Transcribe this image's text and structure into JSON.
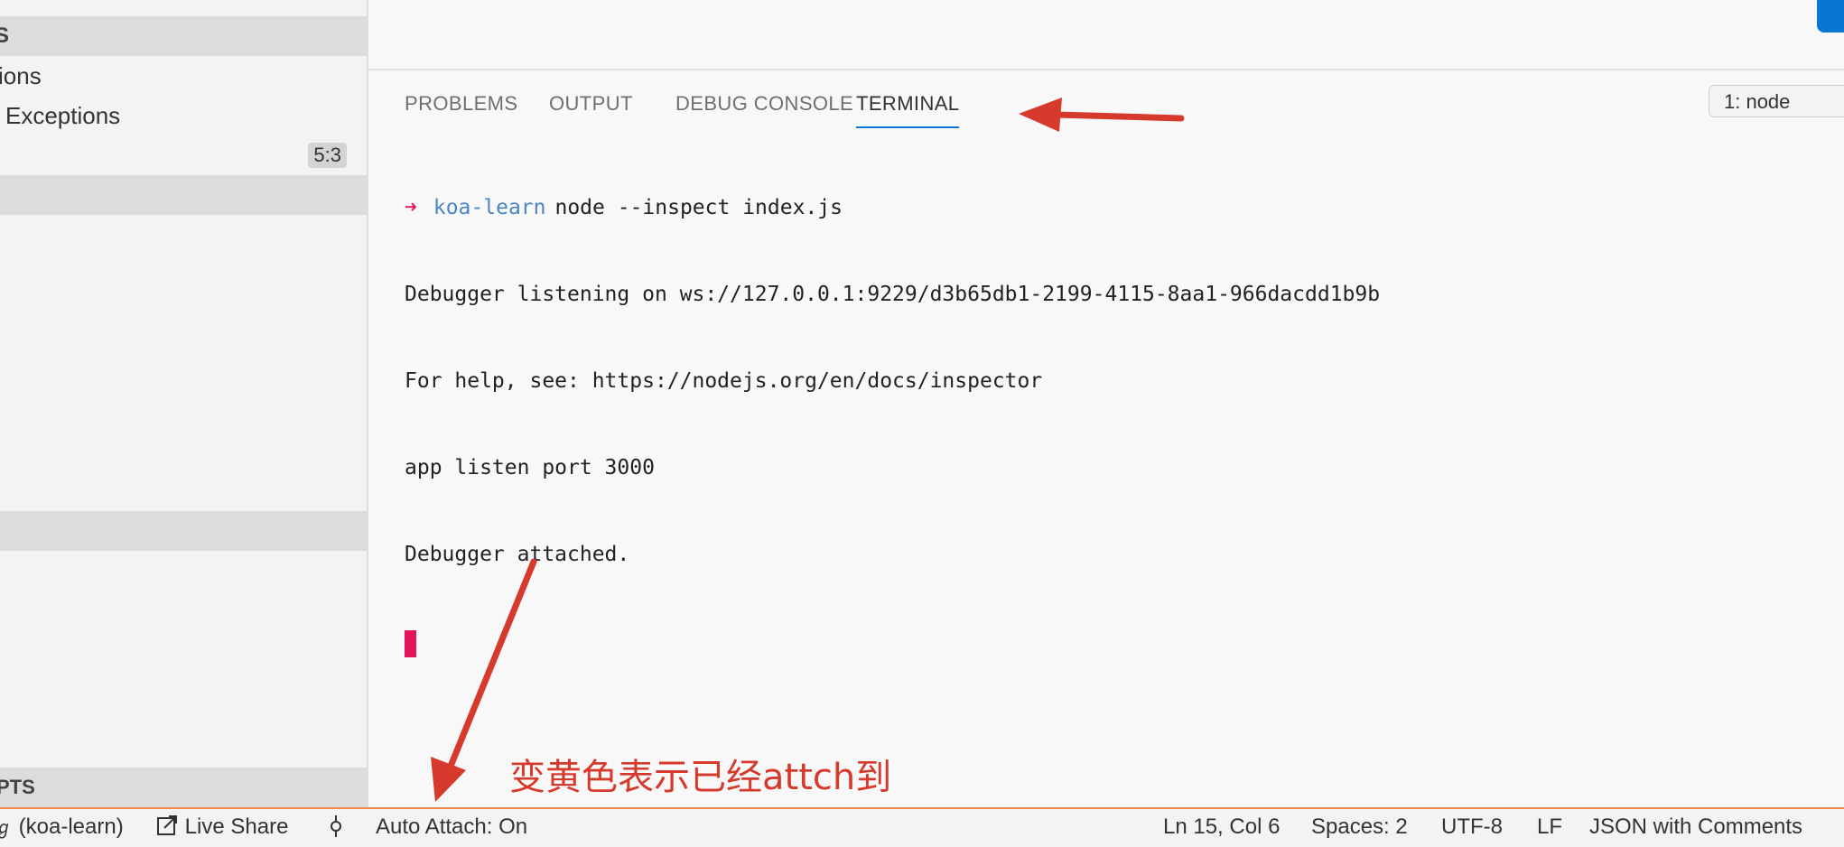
{
  "sidebar": {
    "section_top": "S",
    "item_1": "ions",
    "item_2": "Exceptions",
    "badge": "5:3",
    "section_bottom": "PTS"
  },
  "panel": {
    "tabs": [
      "PROBLEMS",
      "OUTPUT",
      "DEBUG CONSOLE",
      "TERMINAL"
    ],
    "active_tab": "TERMINAL",
    "terminal_selector": "1: node"
  },
  "terminal": {
    "prompt_arrow": "➜",
    "prompt_dir": "koa-learn",
    "command": "node --inspect index.js",
    "lines": [
      "Debugger listening on ws://127.0.0.1:9229/d3b65db1-2199-4115-8aa1-966dacdd1b9b",
      "For help, see: https://nodejs.org/en/docs/inspector",
      "app listen port 3000",
      "Debugger attached."
    ]
  },
  "annotation": {
    "text": "变黄色表示已经attch到",
    "color": "#d63a2c"
  },
  "statusbar": {
    "branch": "(koa-learn)",
    "live_share": "Live Share",
    "auto_attach": "Auto Attach: On",
    "cursor_pos": "Ln 15, Col 6",
    "spaces": "Spaces: 2",
    "encoding": "UTF-8",
    "eol": "LF",
    "language": "JSON with Comments",
    "border_color": "#f08b46"
  },
  "colors": {
    "accent": "#0a76d3",
    "arrow": "#d63a2c",
    "cursor": "#e5125c"
  }
}
